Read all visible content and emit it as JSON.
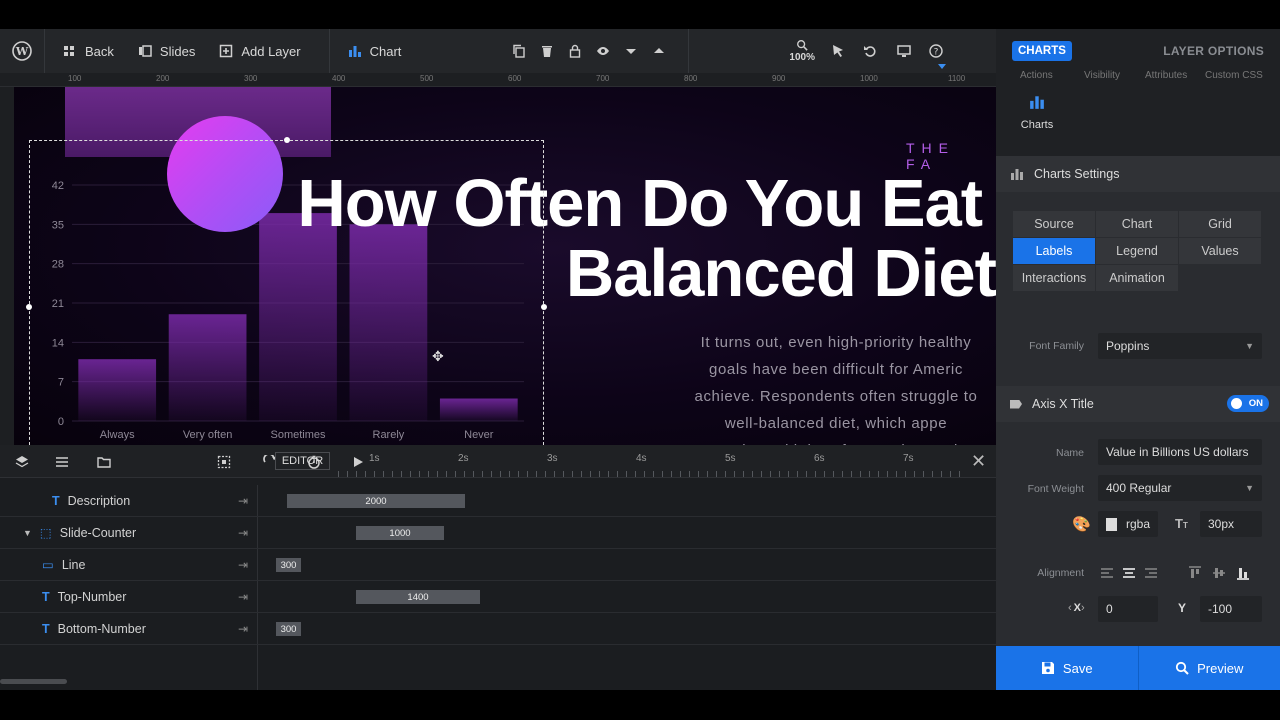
{
  "toolbar": {
    "back": "Back",
    "slides": "Slides",
    "add_layer": "Add Layer",
    "layer_name": "Chart",
    "zoom": "100%"
  },
  "ruler": {
    "top": [
      "100",
      "200",
      "300",
      "400",
      "500",
      "600",
      "700",
      "800",
      "900",
      "1000",
      "1100"
    ]
  },
  "canvas": {
    "tag": "THE FA",
    "headline_line1": "How Often Do You Eat a",
    "headline_line2": "Balanced Diet",
    "body_lines": [
      "It turns out, even high-priority healthy",
      "goals have been difficult for Americ",
      "achieve. Respondents often struggle to",
      "well-balanced diet, which appe",
      "correlate with how frequently people"
    ]
  },
  "chart_data": {
    "type": "bar",
    "categories": [
      "Always",
      "Very often",
      "Sometimes",
      "Rarely",
      "Never"
    ],
    "values": [
      11,
      19,
      37,
      35,
      4
    ],
    "yticks": [
      0,
      7,
      14,
      21,
      28,
      35,
      42
    ],
    "ylim": [
      0,
      42
    ],
    "bar_color": "#7a2aa8"
  },
  "timeline": {
    "editor_label": "EDITOR",
    "ticks": [
      "1s",
      "2s",
      "3s",
      "4s",
      "5s",
      "6s",
      "7s"
    ],
    "rows": [
      {
        "name": "Description",
        "bar": "2000"
      },
      {
        "name": "Slide-Counter",
        "bar": "1000"
      },
      {
        "name": "Line",
        "bar": "300"
      },
      {
        "name": "Top-Number",
        "bar": "1400"
      },
      {
        "name": "Bottom-Number",
        "bar": "300"
      }
    ]
  },
  "panel": {
    "charts_tab": "CHARTS",
    "layer_options": "LAYER OPTIONS",
    "subtabs": [
      "Actions",
      "Visibility",
      "Attributes",
      "Custom CSS"
    ],
    "charts_icon_label": "Charts",
    "settings_title": "Charts Settings",
    "tabs": [
      "Source",
      "Chart",
      "Grid",
      "Labels",
      "Legend",
      "Values",
      "Interactions",
      "Animation"
    ],
    "font_family_label": "Font Family",
    "font_family": "Poppins",
    "axis_title": "Axis X Title",
    "toggle": "ON",
    "name_label": "Name",
    "name_value": "Value in Billions US dollars",
    "weight_label": "Font Weight",
    "weight_value": "400 Regular",
    "color_value": "rgba",
    "font_size": "30px",
    "alignment_label": "Alignment",
    "x_label": "X",
    "x_value": "0",
    "y_label": "Y",
    "y_value": "-100",
    "save": "Save",
    "preview": "Preview"
  },
  "colors": {
    "accent": "#1a73e8",
    "panel": "#2a2c30",
    "toolbar": "#242629"
  }
}
